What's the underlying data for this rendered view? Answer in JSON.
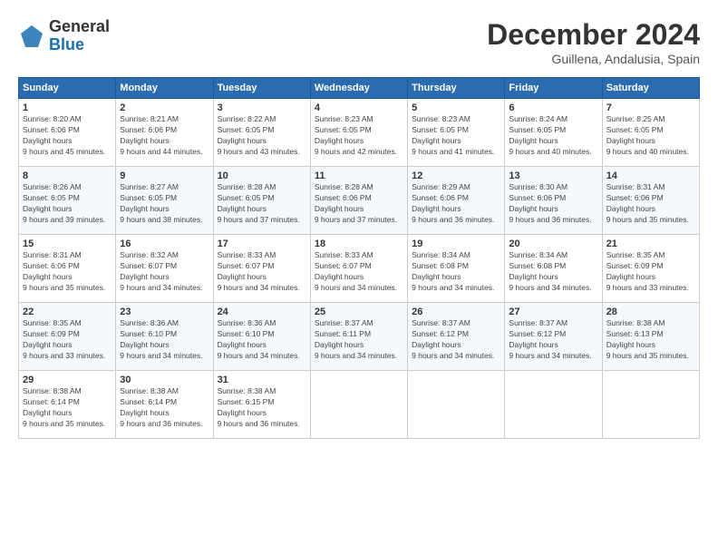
{
  "logo": {
    "general": "General",
    "blue": "Blue"
  },
  "header": {
    "month": "December 2024",
    "location": "Guillena, Andalusia, Spain"
  },
  "weekdays": [
    "Sunday",
    "Monday",
    "Tuesday",
    "Wednesday",
    "Thursday",
    "Friday",
    "Saturday"
  ],
  "weeks": [
    [
      {
        "day": "1",
        "sunrise": "8:20 AM",
        "sunset": "6:06 PM",
        "daylight": "9 hours and 45 minutes."
      },
      {
        "day": "2",
        "sunrise": "8:21 AM",
        "sunset": "6:06 PM",
        "daylight": "9 hours and 44 minutes."
      },
      {
        "day": "3",
        "sunrise": "8:22 AM",
        "sunset": "6:05 PM",
        "daylight": "9 hours and 43 minutes."
      },
      {
        "day": "4",
        "sunrise": "8:23 AM",
        "sunset": "6:05 PM",
        "daylight": "9 hours and 42 minutes."
      },
      {
        "day": "5",
        "sunrise": "8:23 AM",
        "sunset": "6:05 PM",
        "daylight": "9 hours and 41 minutes."
      },
      {
        "day": "6",
        "sunrise": "8:24 AM",
        "sunset": "6:05 PM",
        "daylight": "9 hours and 40 minutes."
      },
      {
        "day": "7",
        "sunrise": "8:25 AM",
        "sunset": "6:05 PM",
        "daylight": "9 hours and 40 minutes."
      }
    ],
    [
      {
        "day": "8",
        "sunrise": "8:26 AM",
        "sunset": "6:05 PM",
        "daylight": "9 hours and 39 minutes."
      },
      {
        "day": "9",
        "sunrise": "8:27 AM",
        "sunset": "6:05 PM",
        "daylight": "9 hours and 38 minutes."
      },
      {
        "day": "10",
        "sunrise": "8:28 AM",
        "sunset": "6:05 PM",
        "daylight": "9 hours and 37 minutes."
      },
      {
        "day": "11",
        "sunrise": "8:28 AM",
        "sunset": "6:06 PM",
        "daylight": "9 hours and 37 minutes."
      },
      {
        "day": "12",
        "sunrise": "8:29 AM",
        "sunset": "6:06 PM",
        "daylight": "9 hours and 36 minutes."
      },
      {
        "day": "13",
        "sunrise": "8:30 AM",
        "sunset": "6:06 PM",
        "daylight": "9 hours and 36 minutes."
      },
      {
        "day": "14",
        "sunrise": "8:31 AM",
        "sunset": "6:06 PM",
        "daylight": "9 hours and 35 minutes."
      }
    ],
    [
      {
        "day": "15",
        "sunrise": "8:31 AM",
        "sunset": "6:06 PM",
        "daylight": "9 hours and 35 minutes."
      },
      {
        "day": "16",
        "sunrise": "8:32 AM",
        "sunset": "6:07 PM",
        "daylight": "9 hours and 34 minutes."
      },
      {
        "day": "17",
        "sunrise": "8:33 AM",
        "sunset": "6:07 PM",
        "daylight": "9 hours and 34 minutes."
      },
      {
        "day": "18",
        "sunrise": "8:33 AM",
        "sunset": "6:07 PM",
        "daylight": "9 hours and 34 minutes."
      },
      {
        "day": "19",
        "sunrise": "8:34 AM",
        "sunset": "6:08 PM",
        "daylight": "9 hours and 34 minutes."
      },
      {
        "day": "20",
        "sunrise": "8:34 AM",
        "sunset": "6:08 PM",
        "daylight": "9 hours and 34 minutes."
      },
      {
        "day": "21",
        "sunrise": "8:35 AM",
        "sunset": "6:09 PM",
        "daylight": "9 hours and 33 minutes."
      }
    ],
    [
      {
        "day": "22",
        "sunrise": "8:35 AM",
        "sunset": "6:09 PM",
        "daylight": "9 hours and 33 minutes."
      },
      {
        "day": "23",
        "sunrise": "8:36 AM",
        "sunset": "6:10 PM",
        "daylight": "9 hours and 34 minutes."
      },
      {
        "day": "24",
        "sunrise": "8:36 AM",
        "sunset": "6:10 PM",
        "daylight": "9 hours and 34 minutes."
      },
      {
        "day": "25",
        "sunrise": "8:37 AM",
        "sunset": "6:11 PM",
        "daylight": "9 hours and 34 minutes."
      },
      {
        "day": "26",
        "sunrise": "8:37 AM",
        "sunset": "6:12 PM",
        "daylight": "9 hours and 34 minutes."
      },
      {
        "day": "27",
        "sunrise": "8:37 AM",
        "sunset": "6:12 PM",
        "daylight": "9 hours and 34 minutes."
      },
      {
        "day": "28",
        "sunrise": "8:38 AM",
        "sunset": "6:13 PM",
        "daylight": "9 hours and 35 minutes."
      }
    ],
    [
      {
        "day": "29",
        "sunrise": "8:38 AM",
        "sunset": "6:14 PM",
        "daylight": "9 hours and 35 minutes."
      },
      {
        "day": "30",
        "sunrise": "8:38 AM",
        "sunset": "6:14 PM",
        "daylight": "9 hours and 36 minutes."
      },
      {
        "day": "31",
        "sunrise": "8:38 AM",
        "sunset": "6:15 PM",
        "daylight": "9 hours and 36 minutes."
      },
      null,
      null,
      null,
      null
    ]
  ],
  "labels": {
    "sunrise": "Sunrise:",
    "sunset": "Sunset:",
    "daylight": "Daylight hours"
  }
}
